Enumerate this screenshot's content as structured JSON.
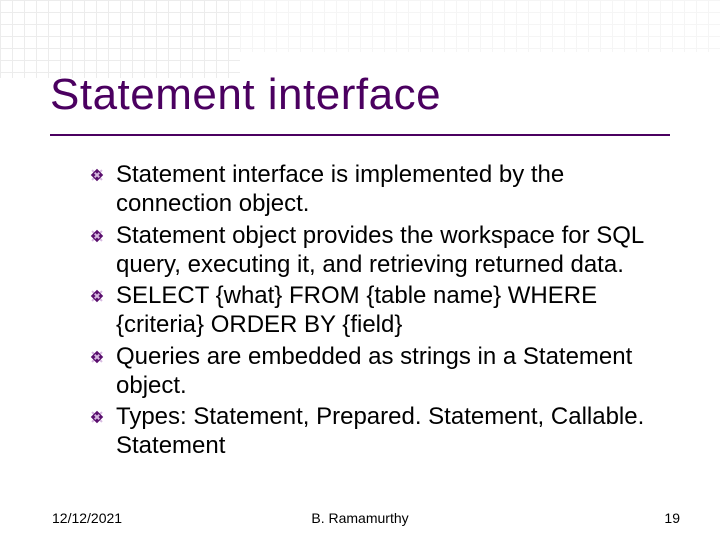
{
  "title": "Statement interface",
  "bullets": [
    "Statement interface is implemented by the connection object.",
    "Statement object provides the workspace for SQL query, executing it, and retrieving returned data.",
    "SELECT {what} FROM {table name} WHERE {criteria} ORDER BY {field}",
    "Queries are embedded as strings in a Statement object.",
    "Types: Statement, Prepared. Statement, Callable. Statement"
  ],
  "footer": {
    "date": "12/12/2021",
    "author": "B. Ramamurthy",
    "page": "19"
  },
  "colors": {
    "title": "#4b0060",
    "bullet_fill": "#5a0f6e"
  }
}
